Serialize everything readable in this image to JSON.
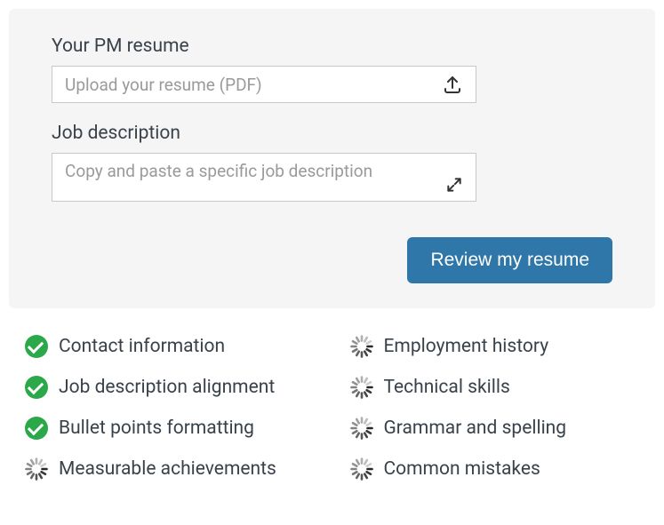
{
  "form": {
    "resume_label": "Your PM resume",
    "resume_placeholder": "Upload your resume (PDF)",
    "jd_label": "Job description",
    "jd_placeholder": "Copy and paste a specific job description",
    "review_button": "Review my resume"
  },
  "checks": {
    "left": [
      {
        "label": "Contact information",
        "status": "done"
      },
      {
        "label": "Job description alignment",
        "status": "done"
      },
      {
        "label": "Bullet points formatting",
        "status": "done"
      },
      {
        "label": "Measurable achievements",
        "status": "loading"
      }
    ],
    "right": [
      {
        "label": "Employment history",
        "status": "loading"
      },
      {
        "label": "Technical skills",
        "status": "loading"
      },
      {
        "label": "Grammar and spelling",
        "status": "loading"
      },
      {
        "label": "Common mistakes",
        "status": "loading"
      }
    ]
  },
  "colors": {
    "panel_bg": "#f5f5f5",
    "button_bg": "#2f77a9",
    "check_done": "#2ba84a"
  }
}
